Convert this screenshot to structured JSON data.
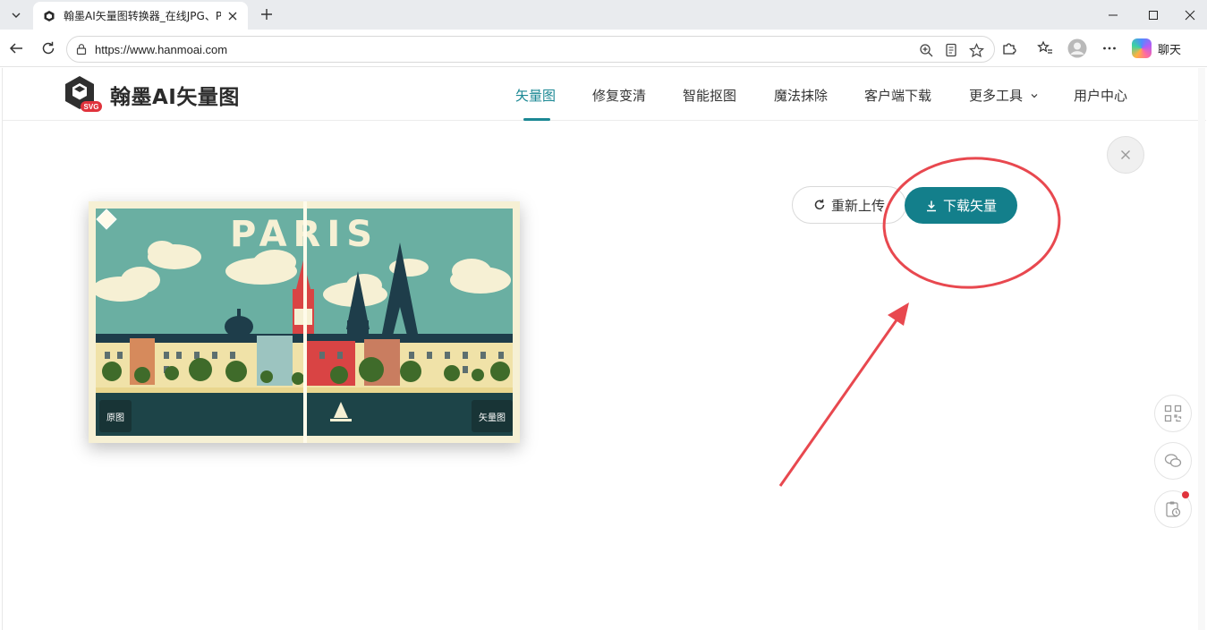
{
  "browser": {
    "tab_title": "翰墨AI矢量图转换器_在线JPG、PNG",
    "url": "https://www.hanmoai.com",
    "copilot_label": "聊天"
  },
  "site": {
    "logo_text": "翰墨AI矢量图",
    "logo_badge": "SVG",
    "nav": {
      "items": [
        "矢量图",
        "修复变清",
        "智能抠图",
        "魔法抹除",
        "客户端下载",
        "更多工具",
        "用户中心"
      ],
      "active_index": 0
    },
    "preview": {
      "image_title": "PARIS",
      "left_tag": "原图",
      "right_tag": "矢量图"
    },
    "actions": {
      "reupload_label": "重新上传",
      "download_label": "下载矢量"
    }
  },
  "colors": {
    "accent": "#137f8b",
    "nav_active": "#1b8894",
    "annotation": "#e8484f"
  }
}
